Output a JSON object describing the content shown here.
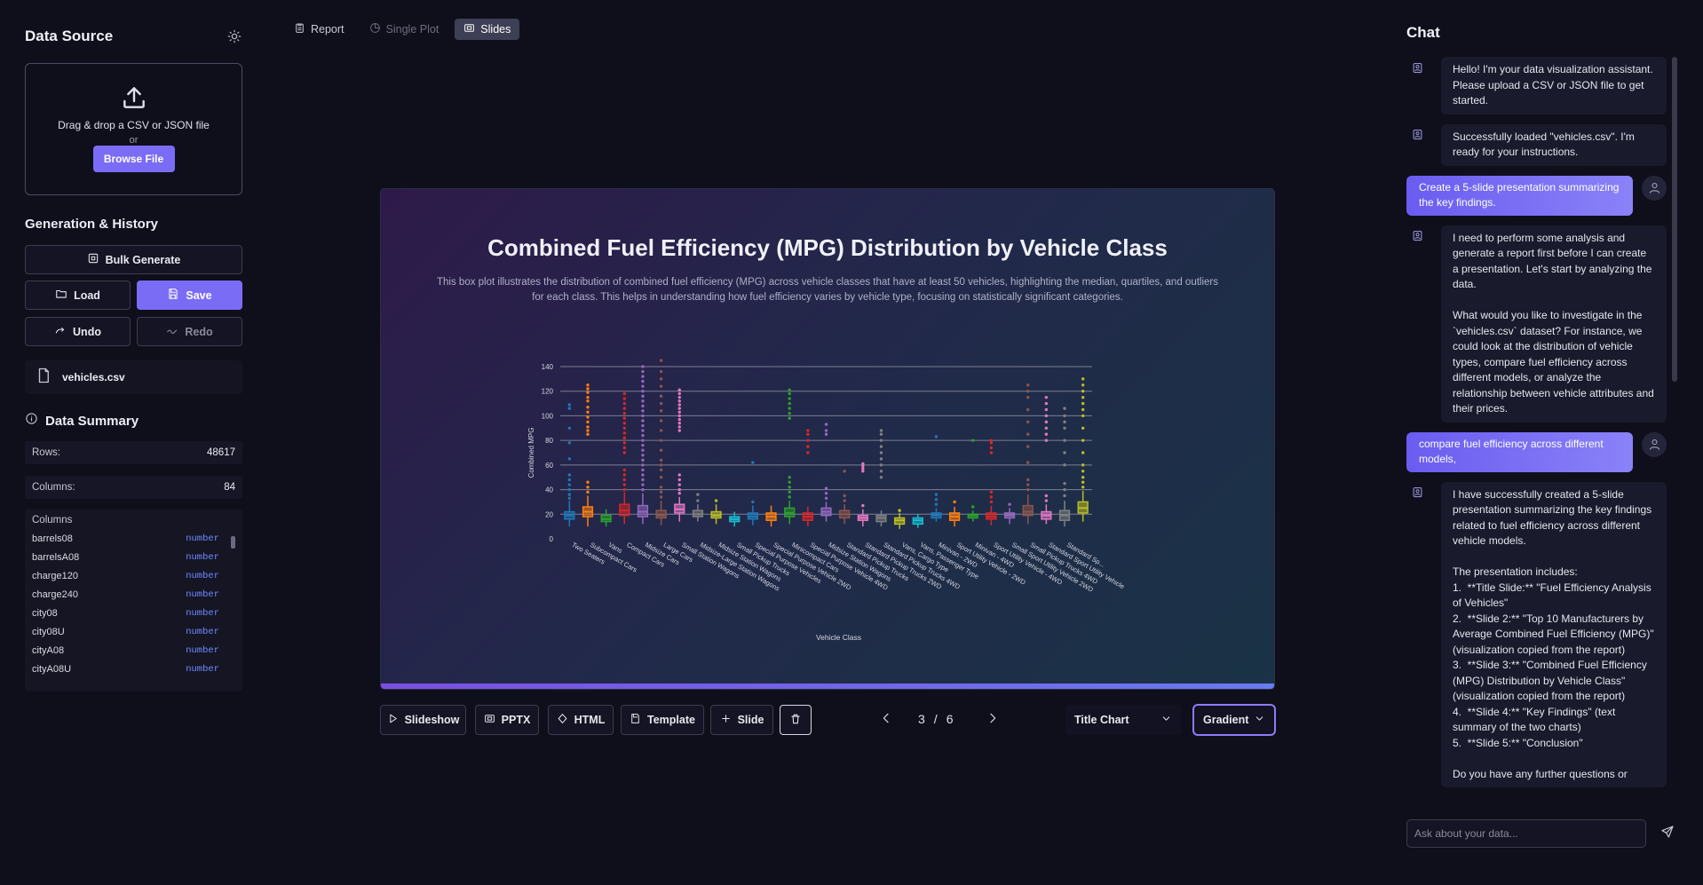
{
  "sidebar": {
    "data_source_title": "Data Source",
    "drop_text": "Drag & drop a CSV or JSON file",
    "or_text": "or",
    "browse_label": "Browse File",
    "gen_title": "Generation & History",
    "bulk_label": "Bulk Generate",
    "load_label": "Load",
    "save_label": "Save",
    "undo_label": "Undo",
    "redo_label": "Redo",
    "file_name": "vehicles.csv",
    "summary_title": "Data Summary",
    "rows_label": "Rows:",
    "rows_value": "48617",
    "columns_label": "Columns:",
    "columns_value": "84",
    "columns_header": "Columns",
    "columns": [
      {
        "name": "barrels08",
        "type": "number"
      },
      {
        "name": "barrelsA08",
        "type": "number"
      },
      {
        "name": "charge120",
        "type": "number"
      },
      {
        "name": "charge240",
        "type": "number"
      },
      {
        "name": "city08",
        "type": "number"
      },
      {
        "name": "city08U",
        "type": "number"
      },
      {
        "name": "cityA08",
        "type": "number"
      },
      {
        "name": "cityA08U",
        "type": "number"
      }
    ]
  },
  "tabs": [
    {
      "label": "Report",
      "icon": "clipboard-icon"
    },
    {
      "label": "Single Plot",
      "icon": "pie-icon"
    },
    {
      "label": "Slides",
      "icon": "slides-icon"
    }
  ],
  "slide": {
    "title": "Combined Fuel Efficiency (MPG) Distribution by Vehicle Class",
    "description": "This box plot illustrates the distribution of combined fuel efficiency (MPG) across vehicle classes that have at least 50 vehicles, highlighting the median, quartiles, and outliers for each class. This helps in understanding how fuel efficiency varies by vehicle type, focusing on statistically significant categories."
  },
  "chart_data": {
    "type": "box",
    "xlabel": "Vehicle Class",
    "ylabel": "Combined MPG",
    "ylim": [
      0,
      140
    ],
    "yticks": [
      0,
      20,
      40,
      60,
      80,
      100,
      120,
      140
    ],
    "categories": [
      "Two Seaters",
      "Subcompact Cars",
      "Vans",
      "Compact Cars",
      "Midsize Cars",
      "Large Cars",
      "Small Station Wagons",
      "Midsize-Large Station Wagons",
      "Midsize Station Wagons",
      "Small Pickup Trucks",
      "Special Purpose Vehicles",
      "Special Purpose Vehicle 2WD",
      "Minicompact Cars",
      "Special Purpose Vehicle 4WD",
      "Midsize Station Wagons",
      "Standard Pickup Trucks",
      "Standard Pickup Trucks 2WD",
      "Standard Pickup Trucks 4WD",
      "Vans, Cargo Type",
      "Vans, Passenger Type",
      "Minivan - 2WD",
      "Sport Utility Vehicle - 2WD",
      "Minivan - 4WD",
      "Sport Utility Vehicle - 4WD",
      "Small Sport Utility Vehicle 2WD",
      "Small Pickup Trucks 4WD",
      "Standard Sport Utility Vehicle",
      "Standard Sp..."
    ],
    "colors": [
      "#1f77b4",
      "#ff7f0e",
      "#2ca02c",
      "#d62728",
      "#9467bd",
      "#8c564b",
      "#e377c2",
      "#7f7f7f",
      "#bcbd22",
      "#17becf",
      "#1f77b4",
      "#ff7f0e",
      "#2ca02c",
      "#d62728",
      "#9467bd",
      "#8c564b",
      "#e377c2",
      "#7f7f7f",
      "#bcbd22",
      "#17becf",
      "#1f77b4",
      "#ff7f0e",
      "#2ca02c",
      "#d62728",
      "#9467bd",
      "#8c564b",
      "#e377c2",
      "#7f7f7f",
      "#bcbd22"
    ],
    "boxes": [
      {
        "min": 10,
        "q1": 16,
        "median": 19,
        "q3": 22,
        "max": 31,
        "outliers": [
          33,
          36,
          40,
          44,
          48,
          52,
          65,
          78,
          90,
          106,
          109
        ]
      },
      {
        "min": 10,
        "q1": 18,
        "median": 22,
        "q3": 26,
        "max": 35,
        "outliers": [
          38,
          42,
          46,
          85,
          88,
          91,
          95,
          99,
          103,
          107,
          112,
          115,
          119,
          122,
          125
        ]
      },
      {
        "min": 10,
        "q1": 14,
        "median": 16,
        "q3": 19,
        "max": 24
      },
      {
        "min": 12,
        "q1": 19,
        "median": 23,
        "q3": 28,
        "max": 38,
        "outliers": [
          40,
          44,
          48,
          52,
          56,
          70,
          74,
          78,
          82,
          86,
          90,
          94,
          98,
          102,
          106,
          110,
          114,
          118
        ]
      },
      {
        "min": 12,
        "q1": 18,
        "median": 22,
        "q3": 27,
        "max": 37,
        "outliers": [
          40,
          44,
          48,
          52,
          56,
          60,
          64,
          68,
          72,
          76,
          80,
          84,
          88,
          92,
          96,
          100,
          104,
          108,
          112,
          116,
          120,
          124,
          128,
          132,
          136,
          140
        ]
      },
      {
        "min": 11,
        "q1": 17,
        "median": 19,
        "q3": 23,
        "max": 31,
        "outliers": [
          34,
          38,
          42,
          50,
          56,
          60,
          64,
          72,
          80,
          88,
          96,
          104,
          110,
          116,
          124,
          130,
          136,
          145
        ]
      },
      {
        "min": 14,
        "q1": 21,
        "median": 24,
        "q3": 28,
        "max": 34,
        "outliers": [
          37,
          40,
          44,
          48,
          52,
          88,
          91,
          94,
          97,
          100,
          103,
          106,
          109,
          112,
          115,
          118,
          121
        ]
      },
      {
        "min": 14,
        "q1": 18,
        "median": 20,
        "q3": 23,
        "max": 28,
        "outliers": [
          31,
          36
        ]
      },
      {
        "min": 12,
        "q1": 17,
        "median": 19,
        "q3": 22,
        "max": 28,
        "outliers": [
          31
        ]
      },
      {
        "min": 10,
        "q1": 14,
        "median": 16,
        "q3": 18,
        "max": 22
      },
      {
        "min": 11,
        "q1": 16,
        "median": 18,
        "q3": 21,
        "max": 27,
        "outliers": [
          30,
          62
        ]
      },
      {
        "min": 10,
        "q1": 15,
        "median": 18,
        "q3": 21,
        "max": 27
      },
      {
        "min": 12,
        "q1": 18,
        "median": 21,
        "q3": 25,
        "max": 31,
        "outliers": [
          34,
          38,
          42,
          46,
          50,
          98,
          102,
          106,
          110,
          114,
          118,
          121
        ]
      },
      {
        "min": 10,
        "q1": 15,
        "median": 18,
        "q3": 21,
        "max": 26,
        "outliers": [
          70,
          75,
          80,
          85,
          88
        ]
      },
      {
        "min": 14,
        "q1": 19,
        "median": 22,
        "q3": 25,
        "max": 30,
        "outliers": [
          33,
          37,
          41,
          85,
          88,
          93
        ]
      },
      {
        "min": 12,
        "q1": 17,
        "median": 20,
        "q3": 23,
        "max": 28,
        "outliers": [
          31,
          35,
          55
        ]
      },
      {
        "min": 10,
        "q1": 15,
        "median": 17,
        "q3": 19,
        "max": 24,
        "outliers": [
          27,
          55,
          57,
          59,
          61
        ]
      },
      {
        "min": 10,
        "q1": 14,
        "median": 17,
        "q3": 19,
        "max": 23,
        "outliers": [
          50,
          55,
          60,
          65,
          70,
          75,
          80,
          85,
          88
        ]
      },
      {
        "min": 8,
        "q1": 12,
        "median": 15,
        "q3": 17,
        "max": 21,
        "outliers": [
          23
        ]
      },
      {
        "min": 9,
        "q1": 12,
        "median": 15,
        "q3": 17,
        "max": 20
      },
      {
        "min": 14,
        "q1": 17,
        "median": 19,
        "q3": 21,
        "max": 25,
        "outliers": [
          28,
          32,
          36,
          83
        ]
      },
      {
        "min": 10,
        "q1": 15,
        "median": 18,
        "q3": 21,
        "max": 26,
        "outliers": [
          30
        ]
      },
      {
        "min": 14,
        "q1": 17,
        "median": 19,
        "q3": 20,
        "max": 23,
        "outliers": [
          80,
          26
        ]
      },
      {
        "min": 11,
        "q1": 16,
        "median": 18,
        "q3": 21,
        "max": 27,
        "outliers": [
          30,
          34,
          38,
          70,
          74,
          78,
          80
        ]
      },
      {
        "min": 12,
        "q1": 17,
        "median": 19,
        "q3": 21,
        "max": 25,
        "outliers": [
          28
        ]
      },
      {
        "min": 12,
        "q1": 19,
        "median": 22,
        "q3": 27,
        "max": 36,
        "outliers": [
          40,
          44,
          48,
          62,
          75,
          85,
          95,
          105,
          115,
          120,
          125
        ]
      },
      {
        "min": 12,
        "q1": 16,
        "median": 19,
        "q3": 22,
        "max": 28,
        "outliers": [
          31,
          35,
          80,
          85,
          90,
          95,
          100,
          105,
          110,
          115
        ]
      },
      {
        "min": 10,
        "q1": 15,
        "median": 19,
        "q3": 23,
        "max": 31,
        "outliers": [
          35,
          40,
          45,
          60,
          70,
          80,
          90,
          95,
          100,
          106
        ]
      },
      {
        "min": 14,
        "q1": 21,
        "median": 25,
        "q3": 30,
        "max": 39,
        "outliers": [
          42,
          46,
          50,
          55,
          60,
          70,
          80,
          90,
          100,
          105,
          110,
          115,
          120,
          125,
          130
        ]
      }
    ]
  },
  "toolbar": {
    "slideshow_label": "Slideshow",
    "pptx_label": "PPTX",
    "html_label": "HTML",
    "template_label": "Template",
    "slide_label": "Slide",
    "page_current": "3",
    "page_sep": "/",
    "page_total": "6",
    "layout_select": "Title Chart",
    "theme_select": "Gradient"
  },
  "chat": {
    "title": "Chat",
    "messages": [
      {
        "role": "bot",
        "text": "Hello! I'm your data visualization assistant. Please upload a CSV or JSON file to get started."
      },
      {
        "role": "bot",
        "text": "Successfully loaded \"vehicles.csv\". I'm ready for your instructions."
      },
      {
        "role": "user",
        "text": "Create a 5-slide presentation summarizing the key findings."
      },
      {
        "role": "bot",
        "text": "I need to perform some analysis and generate a report first before I can create a presentation. Let's start by analyzing the data.\n\nWhat would you like to investigate in the `vehicles.csv` dataset? For instance, we could look at the distribution of vehicle types, compare fuel efficiency across different models, or analyze the relationship between vehicle attributes and their prices."
      },
      {
        "role": "user",
        "text": "compare fuel efficiency across different models,"
      },
      {
        "role": "bot",
        "text": "I have successfully created a 5-slide presentation summarizing the key findings related to fuel efficiency across different vehicle models.\n\nThe presentation includes:\n1.  **Title Slide:** \"Fuel Efficiency Analysis of Vehicles\"\n2.  **Slide 2:** \"Top 10 Manufacturers by Average Combined Fuel Efficiency (MPG)\" (visualization copied from the report)\n3.  **Slide 3:** \"Combined Fuel Efficiency (MPG) Distribution by Vehicle Class\" (visualization copied from the report)\n4.  **Slide 4:** \"Key Findings\" (text summary of the two charts)\n5.  **Slide 5:** \"Conclusion\"\n\nDo you have any further questions or"
      }
    ],
    "input_placeholder": "Ask about your data..."
  },
  "colors": {
    "accent": "#7b6cf6",
    "background": "#0f0f1c",
    "panel": "#191a2b"
  }
}
